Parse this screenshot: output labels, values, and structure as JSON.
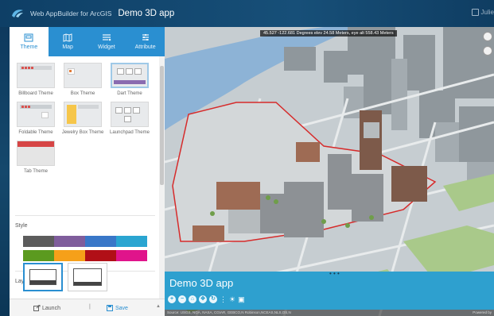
{
  "app": {
    "brand": "Web AppBuilder for ArcGIS",
    "title": "Demo 3D app",
    "user": "Julie",
    "accent": "#2a8fd1"
  },
  "tabs": [
    {
      "label": "Theme",
      "icon": "theme-icon",
      "active": true
    },
    {
      "label": "Map",
      "icon": "map-icon",
      "active": false
    },
    {
      "label": "Widget",
      "icon": "widget-icon",
      "active": false
    },
    {
      "label": "Attribute",
      "icon": "attribute-icon",
      "active": false
    }
  ],
  "themes": [
    {
      "label": "Billboard Theme",
      "selected": false
    },
    {
      "label": "Box Theme",
      "selected": false
    },
    {
      "label": "Dart Theme",
      "selected": true
    },
    {
      "label": "Foldable Theme",
      "selected": false
    },
    {
      "label": "Jewelry Box Theme",
      "selected": false
    },
    {
      "label": "Launchpad Theme",
      "selected": false
    },
    {
      "label": "Tab Theme",
      "selected": false
    }
  ],
  "style": {
    "label": "Style",
    "rows": [
      [
        "#5c5c5c",
        "#7f5d9c",
        "#3977c8",
        "#2aa5d1"
      ],
      [
        "#5b9a1f",
        "#f6a019",
        "#b10f17",
        "#e0148b"
      ]
    ]
  },
  "layout": {
    "label": "Layout",
    "selected_index": 0
  },
  "footer": {
    "launch_label": "Launch",
    "separator": "|",
    "save_label": "Save"
  },
  "map": {
    "coordinates": "45.527  -122.681 Degrees  elev 24.58 Meters,  eye alt 558.43 Meters",
    "banner_title": "Demo 3D app",
    "attribution": "Source: USGS, NGA, NASA, CGIAR, GEBCO,N Robinson,NCEAS,NLS,OS,N",
    "powered_by": "Powered by"
  }
}
